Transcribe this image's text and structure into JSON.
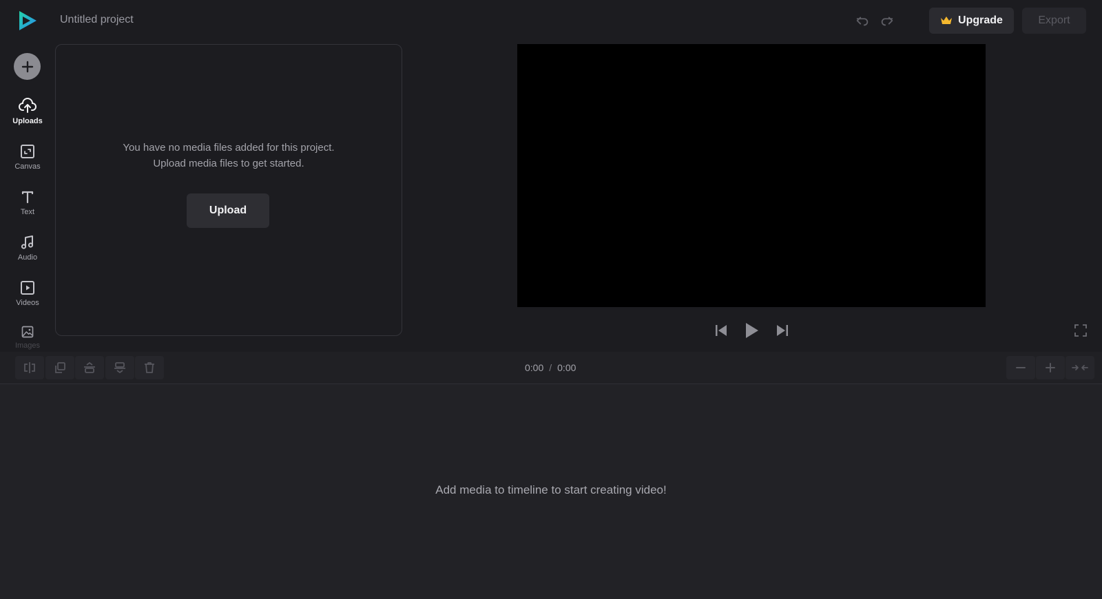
{
  "header": {
    "project_title": "Untitled project",
    "upgrade_label": "Upgrade",
    "export_label": "Export"
  },
  "sidebar": {
    "items": [
      {
        "label": "Uploads",
        "icon": "upload-cloud-icon",
        "active": true
      },
      {
        "label": "Canvas",
        "icon": "canvas-icon"
      },
      {
        "label": "Text",
        "icon": "text-icon"
      },
      {
        "label": "Audio",
        "icon": "music-note-icon"
      },
      {
        "label": "Videos",
        "icon": "video-icon"
      },
      {
        "label": "Images",
        "icon": "image-icon"
      }
    ]
  },
  "media_panel": {
    "empty_line1": "You have no media files added for this project.",
    "empty_line2": "Upload media files to get started.",
    "upload_label": "Upload"
  },
  "player": {
    "current_time": "0:00",
    "separator": "/",
    "total_time": "0:00"
  },
  "timeline": {
    "empty_message": "Add media to timeline to start creating video!"
  },
  "colors": {
    "background": "#1c1c20",
    "accent_crown": "#f5b82e",
    "logo_blue": "#2a8cf0",
    "logo_teal": "#22d3a6"
  }
}
